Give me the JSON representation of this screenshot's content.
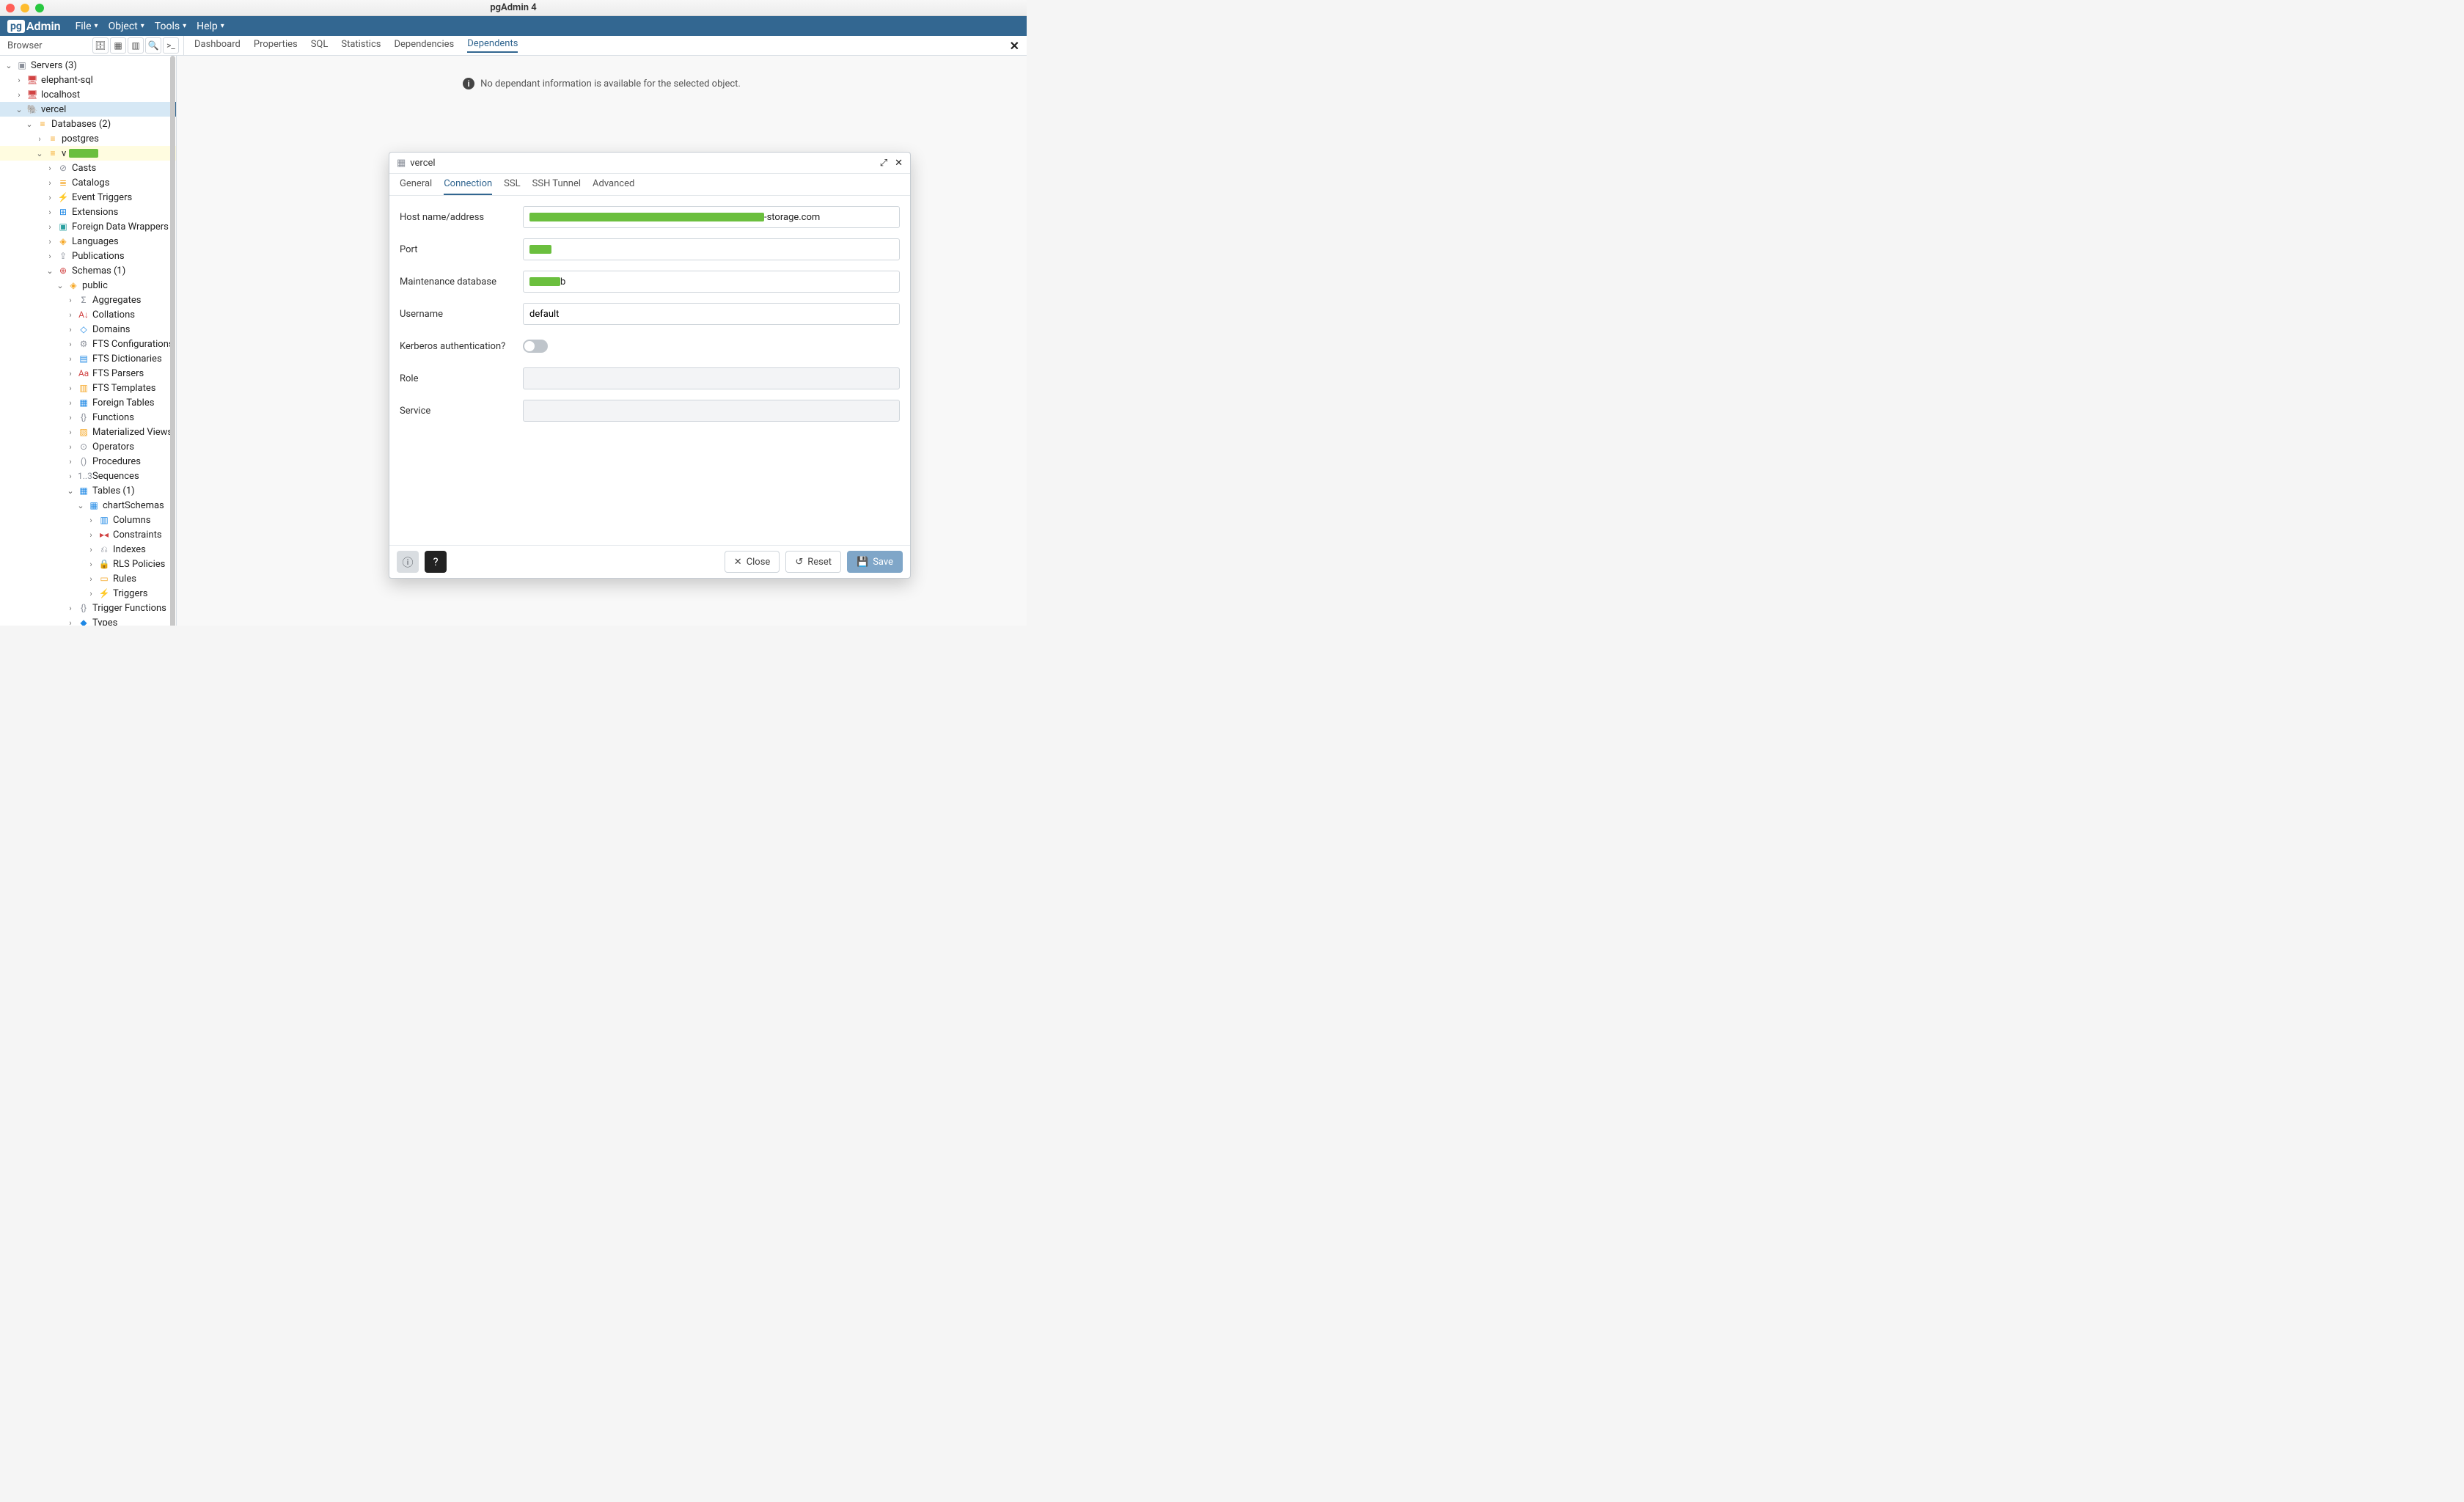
{
  "window": {
    "title": "pgAdmin 4"
  },
  "brand": {
    "prefix": "pg",
    "suffix": "Admin"
  },
  "menubar": [
    "File",
    "Object",
    "Tools",
    "Help"
  ],
  "browser": {
    "label": "Browser"
  },
  "main_tabs": {
    "items": [
      "Dashboard",
      "Properties",
      "SQL",
      "Statistics",
      "Dependencies",
      "Dependents"
    ],
    "active": "Dependents"
  },
  "main_info": "No dependant information is available for the selected object.",
  "tree": {
    "servers_label": "Servers (3)",
    "servers": [
      {
        "label": "elephant-sql",
        "expanded": false
      },
      {
        "label": "localhost",
        "expanded": false
      },
      {
        "label": "vercel",
        "expanded": true,
        "selected": true
      }
    ],
    "databases_label": "Databases (2)",
    "databases": [
      {
        "label": "postgres",
        "expanded": false
      },
      {
        "label": "verceldb",
        "expanded": true,
        "redacted_width": 40
      }
    ],
    "db_children": [
      {
        "label": "Casts",
        "icon": "⊘",
        "color": "i-grey"
      },
      {
        "label": "Catalogs",
        "icon": "≣",
        "color": "i-orange"
      },
      {
        "label": "Event Triggers",
        "icon": "⚡",
        "color": "i-blue"
      },
      {
        "label": "Extensions",
        "icon": "⊞",
        "color": "i-blue"
      },
      {
        "label": "Foreign Data Wrappers",
        "icon": "▣",
        "color": "i-teal"
      },
      {
        "label": "Languages",
        "icon": "◈",
        "color": "i-orange"
      },
      {
        "label": "Publications",
        "icon": "⇪",
        "color": "i-grey"
      },
      {
        "label": "Schemas (1)",
        "icon": "⊕",
        "color": "i-red",
        "expanded": true
      }
    ],
    "schema_public": "public",
    "schema_children": [
      {
        "label": "Aggregates",
        "icon": "Σ",
        "color": "i-grey"
      },
      {
        "label": "Collations",
        "icon": "A↓",
        "color": "i-red"
      },
      {
        "label": "Domains",
        "icon": "◇",
        "color": "i-blue"
      },
      {
        "label": "FTS Configurations",
        "icon": "⚙",
        "color": "i-grey"
      },
      {
        "label": "FTS Dictionaries",
        "icon": "▤",
        "color": "i-blue"
      },
      {
        "label": "FTS Parsers",
        "icon": "Aa",
        "color": "i-red"
      },
      {
        "label": "FTS Templates",
        "icon": "▥",
        "color": "i-orange"
      },
      {
        "label": "Foreign Tables",
        "icon": "▦",
        "color": "i-blue"
      },
      {
        "label": "Functions",
        "icon": "{}",
        "color": "i-grey"
      },
      {
        "label": "Materialized Views",
        "icon": "▨",
        "color": "i-orange"
      },
      {
        "label": "Operators",
        "icon": "⊙",
        "color": "i-grey"
      },
      {
        "label": "Procedures",
        "icon": "()",
        "color": "i-grey"
      },
      {
        "label": "Sequences",
        "icon": "1..3",
        "color": "i-grey"
      },
      {
        "label": "Tables (1)",
        "icon": "▦",
        "color": "i-blue",
        "expanded": true
      }
    ],
    "table_name": "chartSchemas",
    "table_children": [
      {
        "label": "Columns",
        "icon": "▥",
        "color": "i-blue"
      },
      {
        "label": "Constraints",
        "icon": "▸◂",
        "color": "i-red"
      },
      {
        "label": "Indexes",
        "icon": "⎌",
        "color": "i-grey"
      },
      {
        "label": "RLS Policies",
        "icon": "🔒",
        "color": "i-green"
      },
      {
        "label": "Rules",
        "icon": "▭",
        "color": "i-orange"
      },
      {
        "label": "Triggers",
        "icon": "⚡",
        "color": "i-blue"
      }
    ],
    "trailing": [
      {
        "label": "Trigger Functions",
        "icon": "{}",
        "color": "i-grey"
      },
      {
        "label": "Types",
        "icon": "◆",
        "color": "i-blue"
      }
    ]
  },
  "dialog": {
    "title": "vercel",
    "tabs": [
      "General",
      "Connection",
      "SSL",
      "SSH Tunnel",
      "Advanced"
    ],
    "active_tab": "Connection",
    "fields": {
      "host": {
        "label": "Host name/address",
        "suffix": "-storage.com",
        "redact_width": 320
      },
      "port": {
        "label": "Port",
        "redact_width": 30
      },
      "maintdb": {
        "label": "Maintenance database",
        "value": "b",
        "redact_width": 42
      },
      "username": {
        "label": "Username",
        "value": "default"
      },
      "kerberos": {
        "label": "Kerberos authentication?",
        "value": false
      },
      "role": {
        "label": "Role",
        "value": ""
      },
      "service": {
        "label": "Service",
        "value": ""
      }
    },
    "buttons": {
      "close": "Close",
      "reset": "Reset",
      "save": "Save"
    }
  }
}
